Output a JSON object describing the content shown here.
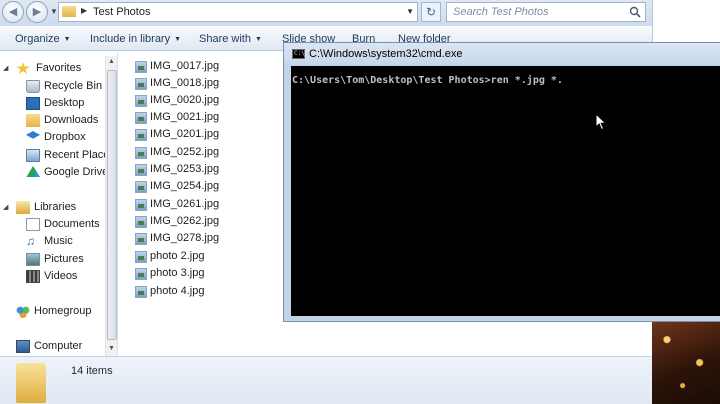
{
  "explorer": {
    "address": {
      "path": "Test Photos"
    },
    "search": {
      "placeholder": "Search Test Photos"
    },
    "toolbar": {
      "organize": "Organize",
      "include_in_library": "Include in library",
      "share_with": "Share with",
      "slide_show": "Slide show",
      "burn": "Burn",
      "new_folder": "New folder"
    },
    "nav": {
      "favorites": "Favorites",
      "recycle_bin": "Recycle Bin",
      "desktop": "Desktop",
      "downloads": "Downloads",
      "dropbox": "Dropbox",
      "recent_places": "Recent Places",
      "google_drive": "Google Drive",
      "libraries": "Libraries",
      "documents": "Documents",
      "music": "Music",
      "pictures": "Pictures",
      "videos": "Videos",
      "homegroup": "Homegroup",
      "computer": "Computer"
    },
    "files": [
      "IMG_0017.jpg",
      "IMG_0018.jpg",
      "IMG_0020.jpg",
      "IMG_0021.jpg",
      "IMG_0201.jpg",
      "IMG_0252.jpg",
      "IMG_0253.jpg",
      "IMG_0254.jpg",
      "IMG_0261.jpg",
      "IMG_0262.jpg",
      "IMG_0278.jpg",
      "photo 2.jpg",
      "photo 3.jpg",
      "photo 4.jpg"
    ],
    "details": {
      "item_count": "14 items"
    }
  },
  "cmd": {
    "title": "C:\\Windows\\system32\\cmd.exe",
    "icon_text": "C:\\",
    "line": "C:\\Users\\Tom\\Desktop\\Test Photos>ren *.jpg *."
  },
  "icons": {
    "back": "back-arrow-icon",
    "forward": "forward-arrow-icon",
    "refresh": "refresh-icon",
    "search": "search-icon",
    "folder": "folder-icon",
    "image_file": "image-file-icon"
  },
  "colors": {
    "toolbar_text": "#1e395b",
    "console_bg": "#000000",
    "console_text": "#c0c0c0"
  }
}
